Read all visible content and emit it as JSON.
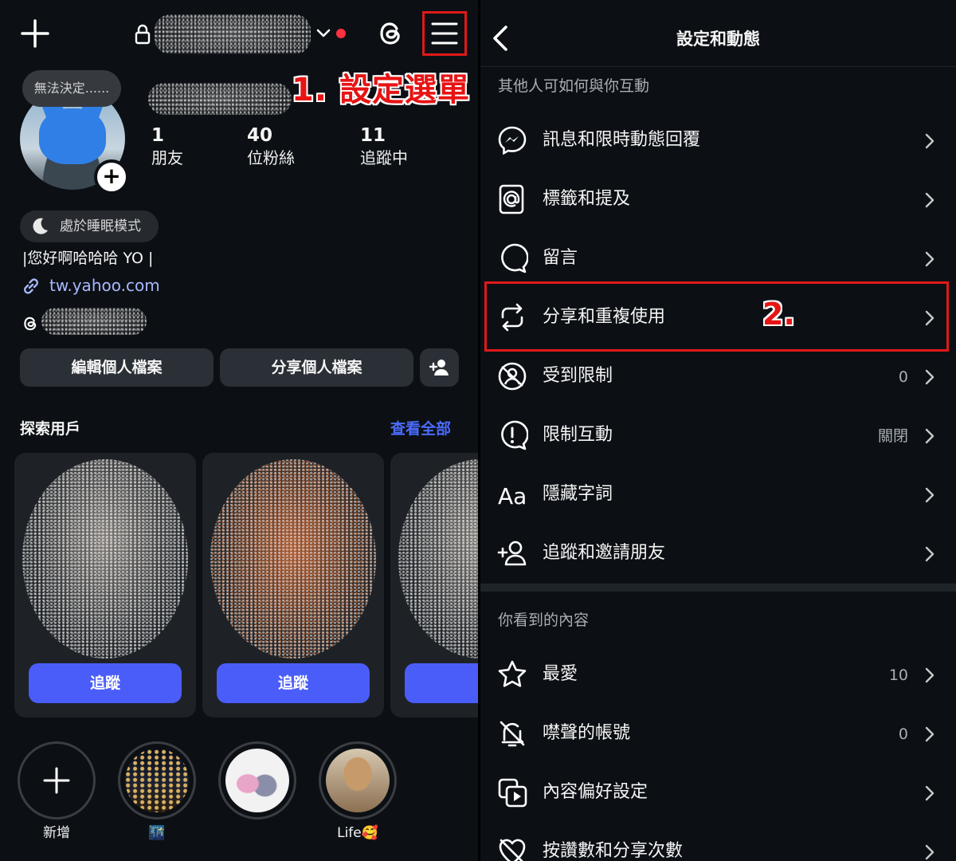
{
  "profile": {
    "note": "無法決定......",
    "stats": [
      {
        "number": "1",
        "label": "朋友"
      },
      {
        "number": "40",
        "label": "位粉絲"
      },
      {
        "number": "11",
        "label": "追蹤中"
      }
    ],
    "sleep_mode": "處於睡眠模式",
    "bio": "|您好啊哈哈哈 YO |",
    "link": "tw.yahoo.com",
    "edit_button": "編輯個人檔案",
    "share_button": "分享個人檔案",
    "discover_title": "探索用戶",
    "discover_all": "查看全部",
    "suggestion_cards": [
      {
        "follow_label": "追蹤"
      },
      {
        "follow_label": "追蹤"
      },
      {
        "follow_label": "追"
      }
    ],
    "highlights": [
      {
        "label": "新增"
      },
      {
        "label": "🌃"
      },
      {
        "label": ""
      },
      {
        "label": "Life🥰"
      }
    ]
  },
  "annotations": {
    "step1": "1. 設定選單",
    "step2": "2."
  },
  "settings": {
    "title": "設定和動態",
    "section1_header": "其他人可如何與你互動",
    "section1_items": [
      {
        "label": "訊息和限時動態回覆",
        "value": "",
        "icon": "messenger-icon"
      },
      {
        "label": "標籤和提及",
        "value": "",
        "icon": "at-sign-icon"
      },
      {
        "label": "留言",
        "value": "",
        "icon": "comment-icon"
      },
      {
        "label": "分享和重複使用",
        "value": "",
        "icon": "share-reuse-icon"
      },
      {
        "label": "受到限制",
        "value": "0",
        "icon": "restricted-icon"
      },
      {
        "label": "限制互動",
        "value": "關閉",
        "icon": "limit-interactions-icon"
      },
      {
        "label": "隱藏字詞",
        "value": "",
        "icon": "hidden-words-icon"
      },
      {
        "label": "追蹤和邀請朋友",
        "value": "",
        "icon": "add-person-icon"
      }
    ],
    "section2_header": "你看到的內容",
    "section2_items": [
      {
        "label": "最愛",
        "value": "10",
        "icon": "star-icon"
      },
      {
        "label": "噤聲的帳號",
        "value": "0",
        "icon": "muted-bell-icon"
      },
      {
        "label": "內容偏好設定",
        "value": "",
        "icon": "content-preferences-icon"
      },
      {
        "label": "按讚數和分享次數",
        "value": "",
        "icon": "like-count-icon"
      }
    ]
  }
}
